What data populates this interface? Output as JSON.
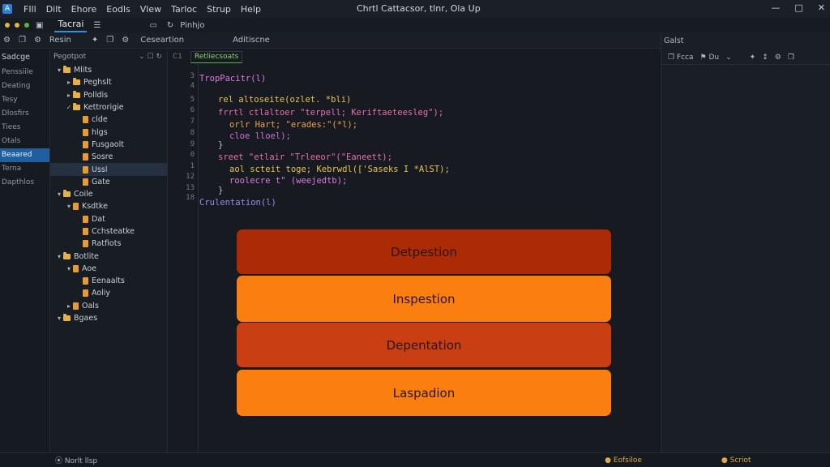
{
  "titlebar": {
    "logo": "A",
    "menus": [
      "FIll",
      "Dilt",
      "Ehore",
      "Eodls",
      "Vlew",
      "Tarloc",
      "Strup",
      "Help"
    ],
    "window_title": "Chrtl Cattacsor, tlnr, Ola Up",
    "controls": [
      "—",
      "□",
      "✕"
    ]
  },
  "toolbar": {
    "dot_colors": [
      "#e8b339",
      "#e8b339",
      "#59b54a"
    ],
    "active_tab": "Tacrai",
    "buttons": [
      "▣",
      "☰",
      "▭",
      "↻",
      "Pinhjo"
    ]
  },
  "subheader": {
    "left_label": "Resin",
    "items": [
      "⚙",
      "❐",
      "⚙",
      "✦",
      "❐",
      "⚙"
    ],
    "middle_label": "Ceseartion",
    "right_label": "Aditiscne",
    "panel_label": "Galst"
  },
  "activity": {
    "title": "Sadcge",
    "items": [
      "Penssiile",
      "Deating",
      "Tesy",
      "Dlosfirs",
      "Tiees",
      "Otals",
      "Beaared",
      "Terna",
      "Dapthlos"
    ],
    "active_index": 6
  },
  "explorer": {
    "title": "Pegotpot",
    "items": [
      {
        "indent": 0,
        "chev": "▾",
        "kind": "folder",
        "label": "Mlits"
      },
      {
        "indent": 1,
        "chev": "▸",
        "kind": "folder",
        "label": "Peghslt"
      },
      {
        "indent": 1,
        "chev": "▸",
        "kind": "folder",
        "label": "Polldis"
      },
      {
        "indent": 1,
        "chev": "✓",
        "kind": "folder",
        "label": "Kettrorigie"
      },
      {
        "indent": 2,
        "chev": "",
        "kind": "file",
        "label": "clde"
      },
      {
        "indent": 2,
        "chev": "",
        "kind": "file",
        "label": "hlgs"
      },
      {
        "indent": 2,
        "chev": "",
        "kind": "file",
        "label": "Fusgaolt"
      },
      {
        "indent": 2,
        "chev": "",
        "kind": "file",
        "label": "Sosre"
      },
      {
        "indent": 2,
        "chev": "",
        "kind": "file",
        "label": "Ussl"
      },
      {
        "indent": 2,
        "chev": "",
        "kind": "file",
        "label": "Gate"
      },
      {
        "indent": 0,
        "chev": "▾",
        "kind": "folder",
        "label": "Coile"
      },
      {
        "indent": 1,
        "chev": "▾",
        "kind": "file",
        "label": "Ksdtke"
      },
      {
        "indent": 2,
        "chev": "",
        "kind": "file",
        "label": "Dat"
      },
      {
        "indent": 2,
        "chev": "",
        "kind": "file",
        "label": "Cchsteatke"
      },
      {
        "indent": 2,
        "chev": "",
        "kind": "file",
        "label": "Ratfiots"
      },
      {
        "indent": 0,
        "chev": "▾",
        "kind": "folder",
        "label": "Botlite"
      },
      {
        "indent": 1,
        "chev": "▾",
        "kind": "file",
        "label": "Aoe"
      },
      {
        "indent": 2,
        "chev": "",
        "kind": "file",
        "label": "Eenaalts"
      },
      {
        "indent": 2,
        "chev": "",
        "kind": "file",
        "label": "Aoliy"
      },
      {
        "indent": 1,
        "chev": "▸",
        "kind": "file",
        "label": "Oals"
      },
      {
        "indent": 0,
        "chev": "▾",
        "kind": "folder",
        "label": "Bgaes"
      }
    ],
    "selected_index": 8
  },
  "editor": {
    "tab_number": "C1",
    "tab_label": "Retliecsoats",
    "line_numbers": [
      "3",
      "4",
      "5",
      "6",
      "7",
      "8",
      "9",
      "0",
      "1",
      "12",
      "13",
      "18"
    ],
    "code": [
      {
        "text": "TropPacitr(l)",
        "color": "#d77ce0"
      },
      {
        "text": "rel altoseite(ozlet. *bli)",
        "color": "#e3c454"
      },
      {
        "text": "frrtl ctlaltoer \"terpell; Keriftaeteesleg\");",
        "color": "#e86fb0"
      },
      {
        "text": "orlr Hart; \"erades:\"(*l);",
        "color": "#f0a04a"
      },
      {
        "text": "cloe lloel);",
        "color": "#cf6fe0"
      },
      {
        "text": "}",
        "color": "#b8c2cc"
      },
      {
        "text": "sreet \"etlair \"Trleeor\"(\"Eaneett);",
        "color": "#e86fb0"
      },
      {
        "text": "aol scteit toge; Kebrwdl(['Saseks I *AlST);",
        "color": "#e3c454"
      },
      {
        "text": "roolecre t\" (weejedtb);",
        "color": "#d77ce0"
      },
      {
        "text": "}",
        "color": "#b8c2cc"
      },
      {
        "text": "Crulentation(l)",
        "color": "#9b8bf0"
      }
    ]
  },
  "stack": {
    "items": [
      {
        "label": "Detpestion",
        "color": "#ad2a06"
      },
      {
        "label": "Inspestion",
        "color": "#fa7e10"
      },
      {
        "label": "Depentation",
        "color": "#c93e13"
      },
      {
        "label": "Laspadion",
        "color": "#fa7e10"
      }
    ]
  },
  "rightpanel": {
    "title": "Galst",
    "tools": [
      "❐ Fcca",
      "⚑ Du",
      "⌄",
      "✦",
      "↕",
      "⚙",
      "❐"
    ]
  },
  "statusbar": {
    "left": "⦿ Norlt llsp",
    "mid": "● Eofsiloe",
    "right": "● Scriot"
  }
}
